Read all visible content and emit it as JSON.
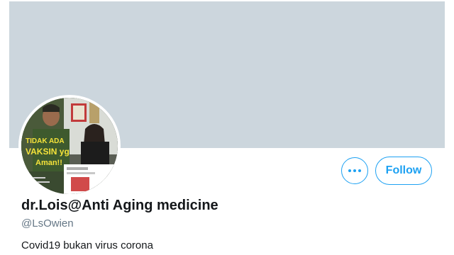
{
  "profile": {
    "display_name": "dr.Lois@Anti Aging medicine",
    "handle": "@LsOwien",
    "bio": "Covid19 bukan virus corona",
    "follow_label": "Follow",
    "avatar_overlay_text": [
      "TIDAK ADA",
      "VAKSIN yg",
      "Aman!!"
    ]
  },
  "colors": {
    "banner": "#ccd6dd",
    "accent": "#1da1f2",
    "text": "#14171a",
    "muted": "#657786"
  },
  "icons": {
    "more": "more-horizontal-icon"
  }
}
